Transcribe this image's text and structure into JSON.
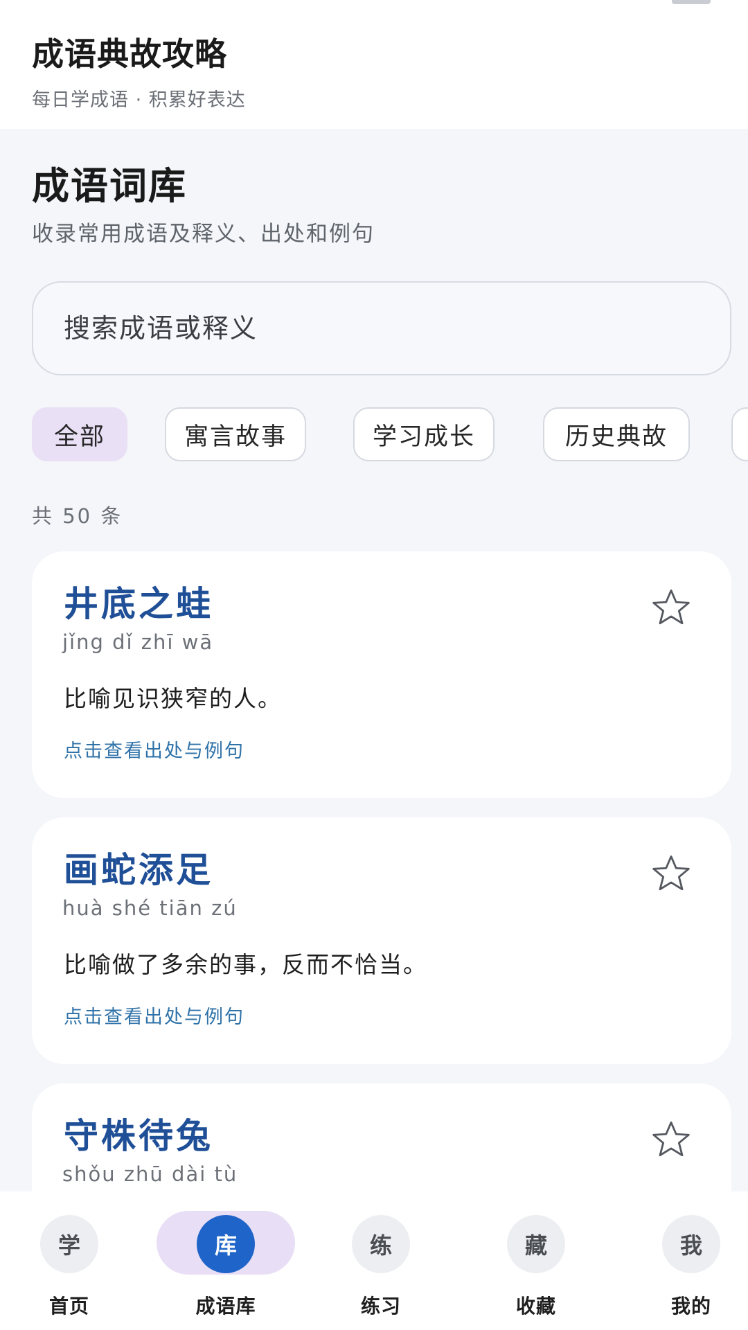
{
  "appbar": {
    "title": "成语典故攻略",
    "subtitle": "每日学成语 · 积累好表达"
  },
  "page": {
    "title": "成语词库",
    "subtitle": "收录常用成语及释义、出处和例句"
  },
  "search": {
    "placeholder": "搜索成语或释义",
    "value": ""
  },
  "chips": [
    {
      "label": "全部",
      "active": true
    },
    {
      "label": "寓言故事",
      "active": false
    },
    {
      "label": "学习成长",
      "active": false
    },
    {
      "label": "历史典故",
      "active": false
    }
  ],
  "count_text": "共 50 条",
  "cards": [
    {
      "name": "井底之蛙",
      "pinyin": "jǐng dǐ zhī wā",
      "meaning": "比喻见识狭窄的人。",
      "link": "点击查看出处与例句",
      "favorited": false
    },
    {
      "name": "画蛇添足",
      "pinyin": "huà shé tiān zú",
      "meaning": "比喻做了多余的事，反而不恰当。",
      "link": "点击查看出处与例句",
      "favorited": false
    },
    {
      "name": "守株待兔",
      "pinyin": "shǒu zhū dài tù",
      "meaning": "",
      "link": "",
      "favorited": false
    }
  ],
  "nav": [
    {
      "icon_text": "学",
      "label": "首页",
      "active": false
    },
    {
      "icon_text": "库",
      "label": "成语库",
      "active": true
    },
    {
      "icon_text": "练",
      "label": "练习",
      "active": false
    },
    {
      "icon_text": "藏",
      "label": "收藏",
      "active": false
    },
    {
      "icon_text": "我",
      "label": "我的",
      "active": false
    }
  ],
  "colors": {
    "accent": "#1f64c8",
    "title_blue": "#1f4f97",
    "link_blue": "#2f72a8",
    "chip_active_bg": "#e9e0f6"
  }
}
